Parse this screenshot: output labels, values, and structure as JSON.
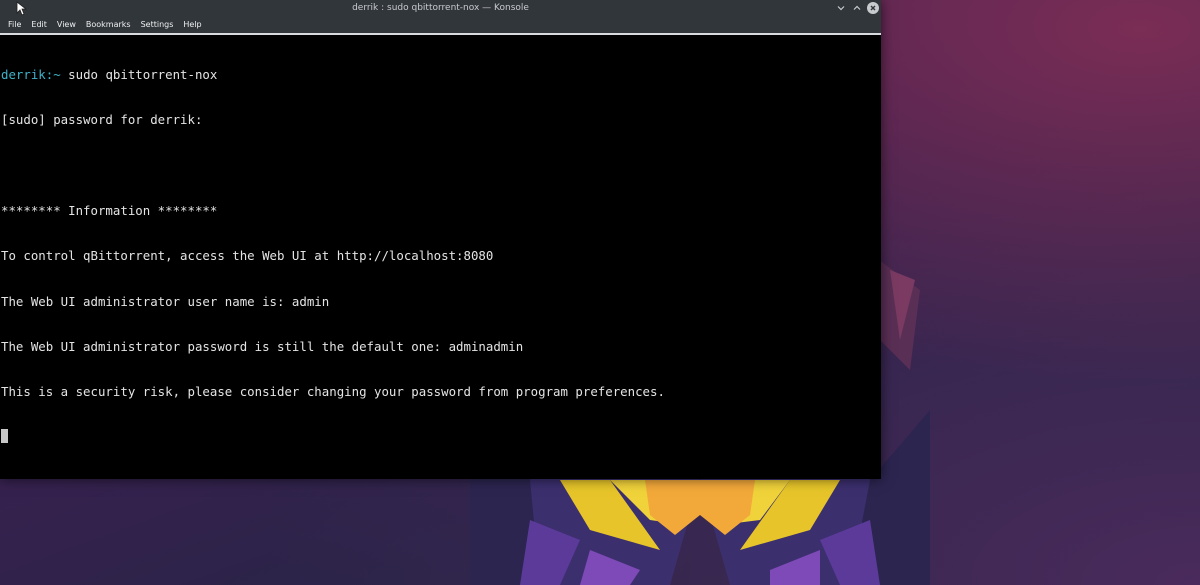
{
  "window": {
    "title": "derrik : sudo qbittorrent-nox — Konsole",
    "controls": {
      "minimize": "chevron-down-icon",
      "maximize": "chevron-up-icon",
      "close": "close-icon"
    }
  },
  "menubar": {
    "items": [
      "File",
      "Edit",
      "View",
      "Bookmarks",
      "Settings",
      "Help"
    ]
  },
  "terminal": {
    "prompt": {
      "user": "derrik",
      "separator": ":~",
      "command": " sudo qbittorrent-nox"
    },
    "lines": [
      "[sudo] password for derrik:",
      "",
      "******** Information ********",
      "To control qBittorrent, access the Web UI at http://localhost:8080",
      "The Web UI administrator user name is: admin",
      "The Web UI administrator password is still the default one: adminadmin",
      "This is a security risk, please consider changing your password from program preferences."
    ]
  },
  "colors": {
    "titlebar": "#31363b",
    "terminal_bg": "#000000",
    "terminal_fg": "#e4e4e4",
    "prompt": "#3fb2c8"
  }
}
